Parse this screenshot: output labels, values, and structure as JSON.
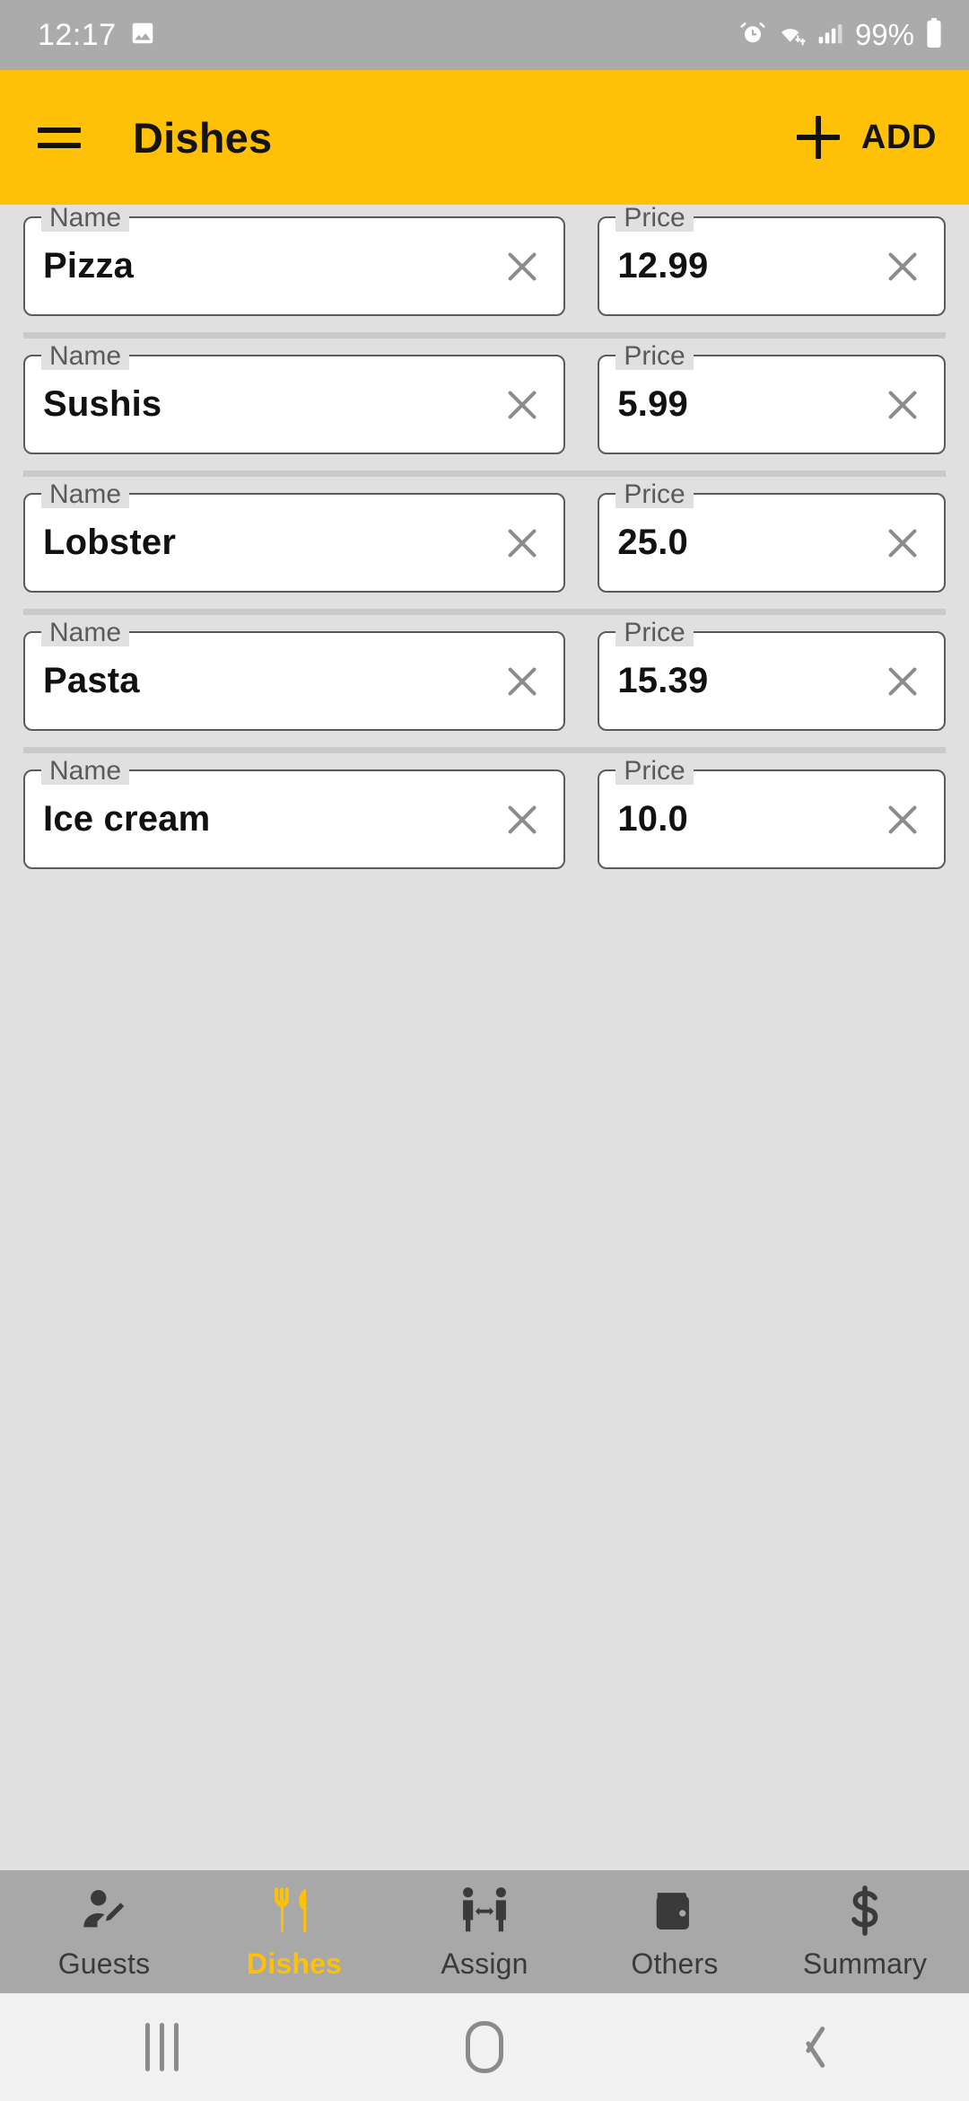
{
  "status_bar": {
    "time": "12:17",
    "battery_percent": "99%",
    "icons": [
      "image-icon",
      "alarm-icon",
      "wifi-icon",
      "signal-icon",
      "battery-icon"
    ]
  },
  "app_bar": {
    "title": "Dishes",
    "menu_icon": "hamburger-menu-icon",
    "add_icon": "plus-icon",
    "add_label": "ADD",
    "background_color": "#FFC107",
    "text_color": "#141414"
  },
  "fields": {
    "name_label": "Name",
    "price_label": "Price",
    "clear_icon": "close-x-icon"
  },
  "dishes": [
    {
      "name": "Pizza",
      "price": "12.99"
    },
    {
      "name": "Sushis",
      "price": "5.99"
    },
    {
      "name": "Lobster",
      "price": "25.0"
    },
    {
      "name": "Pasta",
      "price": "15.39"
    },
    {
      "name": "Ice cream",
      "price": "10.0"
    }
  ],
  "bottom_nav": {
    "active_color": "#FFC107",
    "inactive_color": "#3A3A3A",
    "background_color": "#A8A8A8",
    "items": [
      {
        "label": "Guests",
        "icon": "person-edit-icon",
        "active": false
      },
      {
        "label": "Dishes",
        "icon": "fork-knife-icon",
        "active": true
      },
      {
        "label": "Assign",
        "icon": "people-arrows-icon",
        "active": false
      },
      {
        "label": "Others",
        "icon": "wallet-icon",
        "active": false
      },
      {
        "label": "Summary",
        "icon": "dollar-sign-icon",
        "active": false
      }
    ]
  },
  "android_nav": {
    "recents_icon": "recents-icon",
    "home_icon": "home-icon",
    "back_icon": "back-icon"
  }
}
